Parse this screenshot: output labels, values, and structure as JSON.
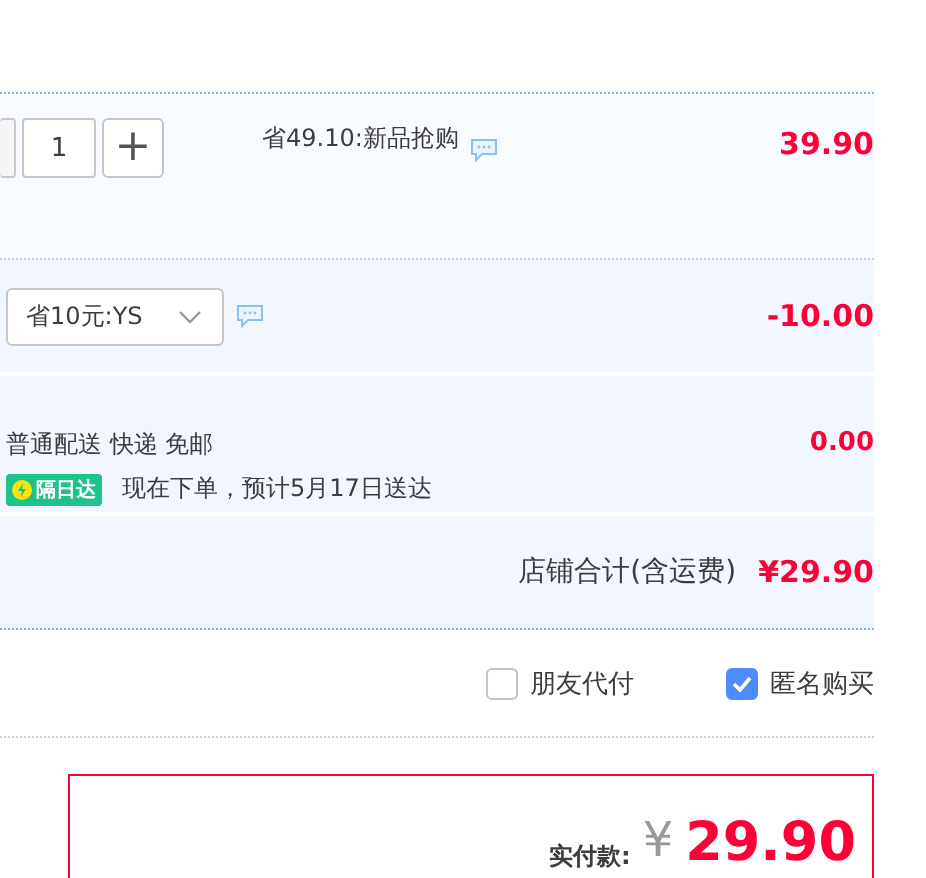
{
  "product": {
    "quantity": "1",
    "plus": "+",
    "promo": "省49.10:新品抢购",
    "price": "39.90"
  },
  "coupon": {
    "selected_value": "省10元:YS",
    "amount": "-10.00"
  },
  "shipping": {
    "method": "普通配送 快递 免邮",
    "badge": "隔日达",
    "estimate": "现在下单，预计5月17日送达",
    "fee": "0.00"
  },
  "store_total": {
    "label": "店铺合计(含运费)",
    "amount": "¥29.90"
  },
  "options": [
    {
      "label": "朋友代付",
      "checked": false
    },
    {
      "label": "匿名购买",
      "checked": true
    }
  ],
  "payment": {
    "label": "实付款:",
    "currency": "¥",
    "amount": "29.90"
  }
}
